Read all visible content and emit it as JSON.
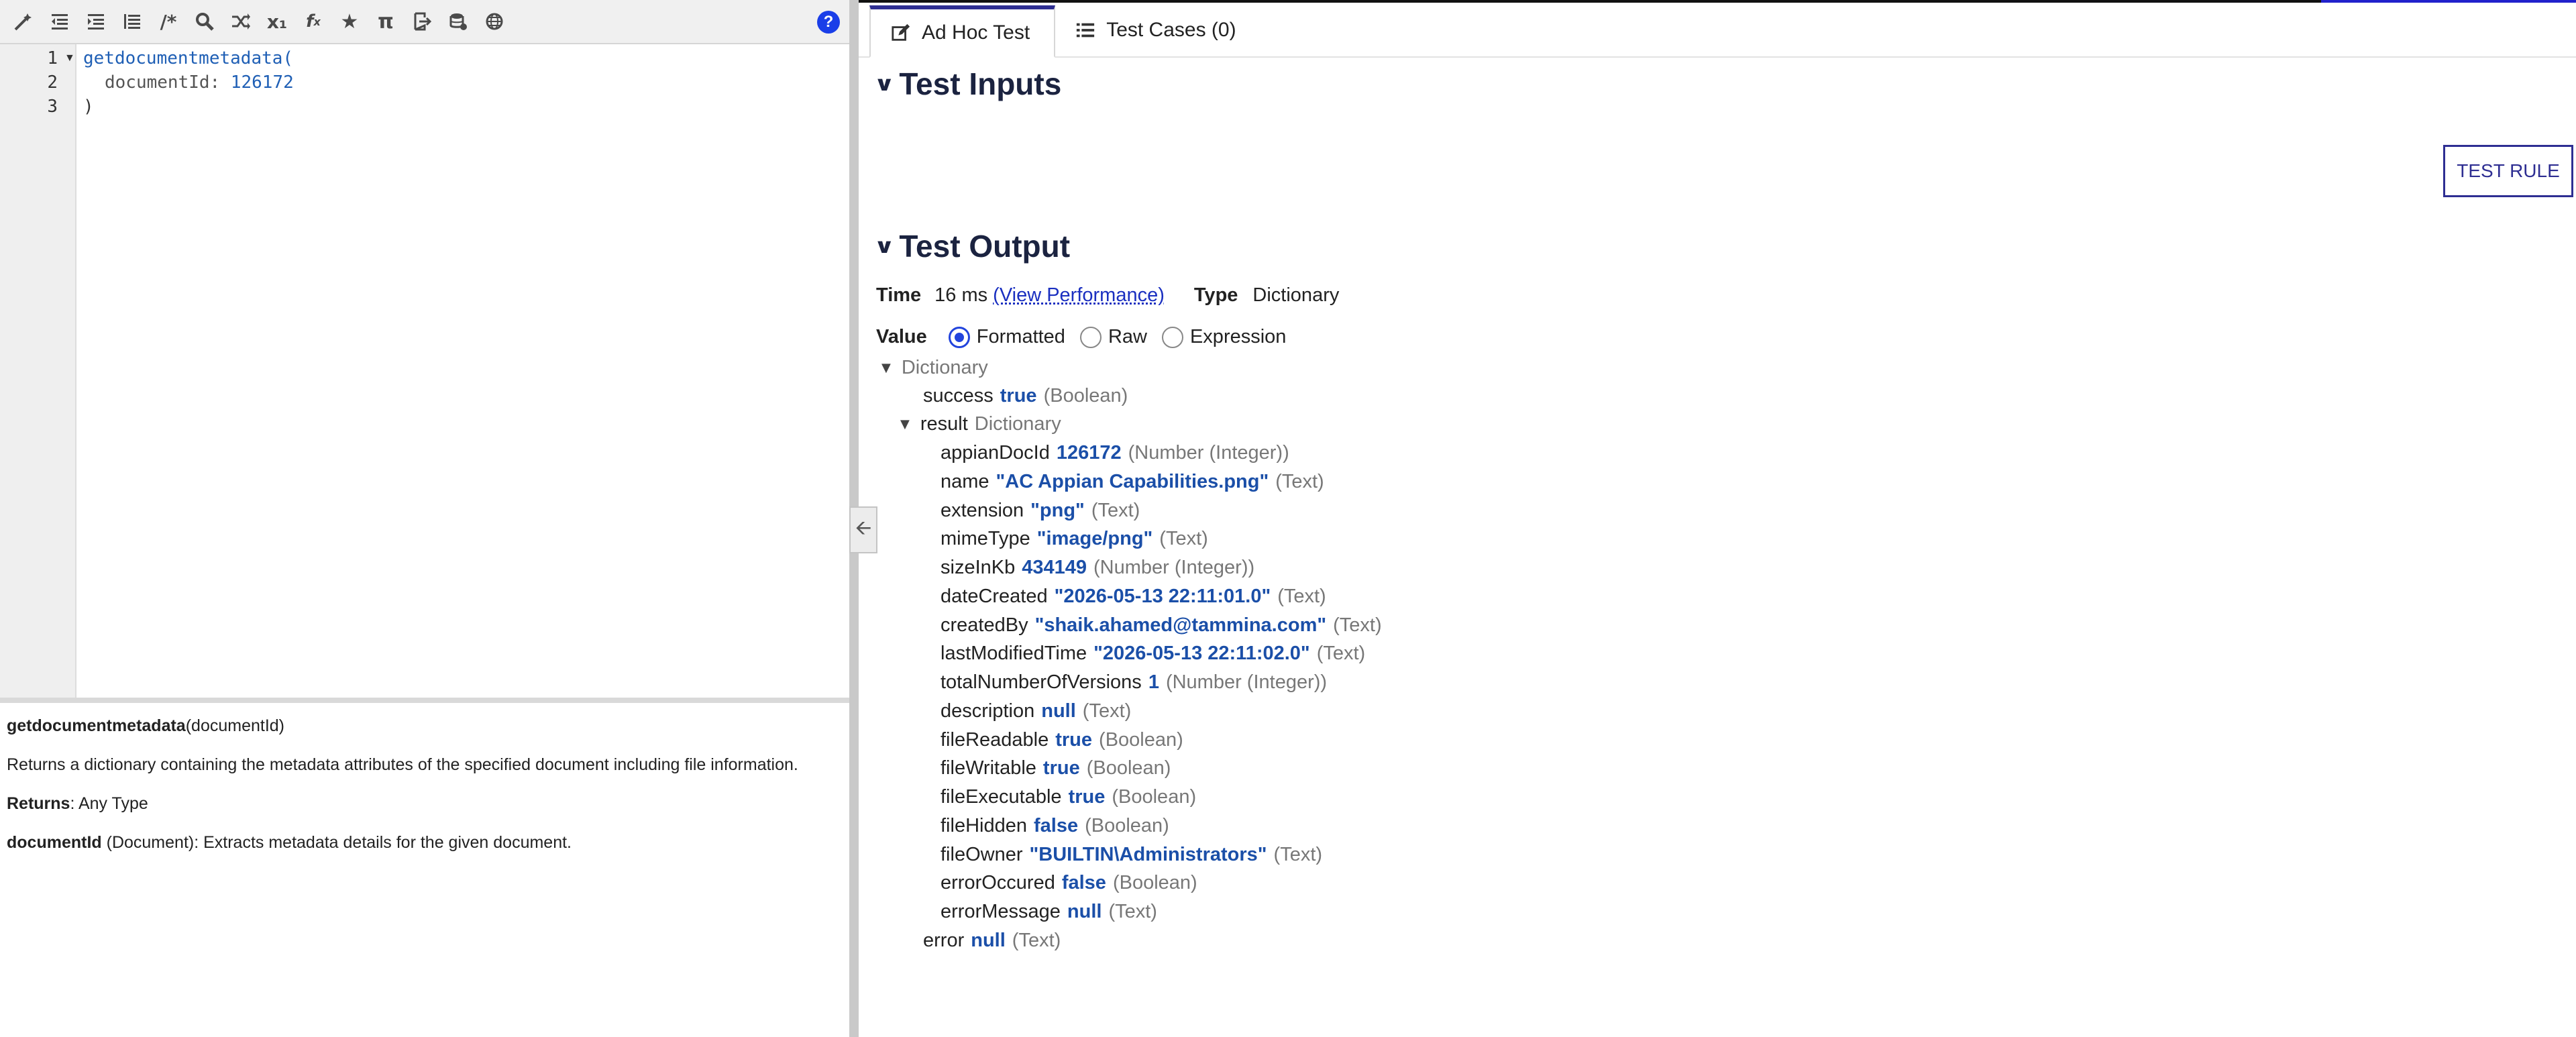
{
  "toolbar": {
    "icons": [
      "magic-wand-icon",
      "outdent-icon",
      "indent-icon",
      "format-icon",
      "comment-icon",
      "search-icon",
      "shuffle-icon",
      "expand-icon",
      "x-sub-icon",
      "function-icon",
      "star-icon",
      "pi-icon",
      "export-icon",
      "database-icon",
      "globe-icon"
    ],
    "comment_glyph": "/*",
    "help_glyph": "?"
  },
  "editor": {
    "line_numbers": [
      "1",
      "2",
      "3"
    ],
    "lines": {
      "l1_fn": "getdocumentmetadata(",
      "l2_key": "documentId:",
      "l2_val": "126172",
      "l3": ")"
    }
  },
  "doc": {
    "fn_name": "getdocumentmetadata",
    "fn_sig": "(documentId)",
    "description": "Returns a dictionary containing the metadata attributes of the specified document including file information.",
    "returns_label": "Returns",
    "returns_value": ": Any Type",
    "param_name": "documentId",
    "param_desc": " (Document): Extracts metadata details for the given document."
  },
  "tabs": [
    {
      "label": "Ad Hoc Test",
      "icon": "edit-icon",
      "active": true
    },
    {
      "label": "Test Cases (0)",
      "icon": "list-icon",
      "active": false
    }
  ],
  "sections": {
    "inputs_title": "Test Inputs",
    "output_title": "Test Output"
  },
  "test_rule_label": "TEST RULE",
  "output_meta": {
    "time_label": "Time",
    "time_value": "16 ms",
    "perf_link": "(View Performance)",
    "type_label": "Type",
    "type_value": "Dictionary",
    "value_label": "Value",
    "formats": [
      "Formatted",
      "Raw",
      "Expression"
    ],
    "selected_format": "Formatted"
  },
  "tree": {
    "root_label": "Dictionary",
    "success": {
      "key": "success",
      "value": "true",
      "type": "(Boolean)"
    },
    "result": {
      "key": "result",
      "type": "Dictionary"
    },
    "fields": [
      {
        "key": "appianDocId",
        "value": "126172",
        "type": "(Number (Integer))"
      },
      {
        "key": "name",
        "value": "\"AC Appian Capabilities.png\"",
        "type": "(Text)"
      },
      {
        "key": "extension",
        "value": "\"png\"",
        "type": "(Text)"
      },
      {
        "key": "mimeType",
        "value": "\"image/png\"",
        "type": "(Text)"
      },
      {
        "key": "sizeInKb",
        "value": "434149",
        "type": "(Number (Integer))"
      },
      {
        "key": "dateCreated",
        "value": "\"2026-05-13 22:11:01.0\"",
        "type": "(Text)"
      },
      {
        "key": "createdBy",
        "value": "\"shaik.ahamed@tammina.com\"",
        "type": "(Text)"
      },
      {
        "key": "lastModifiedTime",
        "value": "\"2026-05-13 22:11:02.0\"",
        "type": "(Text)"
      },
      {
        "key": "totalNumberOfVersions",
        "value": "1",
        "type": "(Number (Integer))"
      },
      {
        "key": "description",
        "value": "null",
        "type": "(Text)"
      },
      {
        "key": "fileReadable",
        "value": "true",
        "type": "(Boolean)"
      },
      {
        "key": "fileWritable",
        "value": "true",
        "type": "(Boolean)"
      },
      {
        "key": "fileExecutable",
        "value": "true",
        "type": "(Boolean)"
      },
      {
        "key": "fileHidden",
        "value": "false",
        "type": "(Boolean)"
      },
      {
        "key": "fileOwner",
        "value": "\"BUILTIN\\Administrators\"",
        "type": "(Text)"
      },
      {
        "key": "errorOccured",
        "value": "false",
        "type": "(Boolean)"
      },
      {
        "key": "errorMessage",
        "value": "null",
        "type": "(Text)"
      }
    ],
    "error": {
      "key": "error",
      "value": "null",
      "type": "(Text)"
    }
  },
  "colors": {
    "accent": "#2e2e92",
    "value_blue": "#1b4fa8",
    "help_blue": "#1a3ee8"
  }
}
